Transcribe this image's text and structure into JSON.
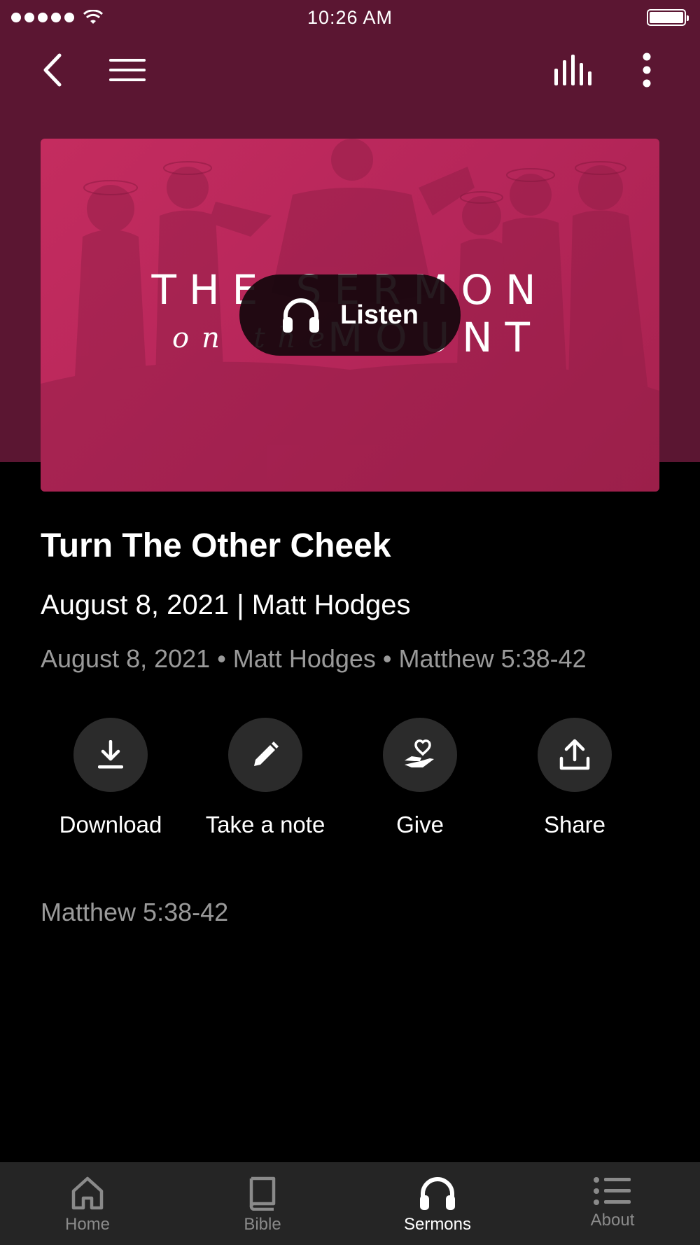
{
  "status_bar": {
    "time": "10:26 AM"
  },
  "artwork": {
    "title_line1": "THE SERMON",
    "title_on": "on the",
    "title_line2": "MOUNT",
    "listen_label": "Listen"
  },
  "sermon": {
    "title": "Turn The Other Cheek",
    "subtitle": "August 8, 2021 | Matt Hodges",
    "meta": "August 8, 2021 • Matt Hodges • Matthew 5:38-42",
    "scripture": "Matthew 5:38-42"
  },
  "actions": [
    {
      "label": "Download",
      "icon": "download-icon"
    },
    {
      "label": "Take a note",
      "icon": "pencil-icon"
    },
    {
      "label": "Give",
      "icon": "give-heart-hand-icon"
    },
    {
      "label": "Share",
      "icon": "share-icon"
    }
  ],
  "tabs": [
    {
      "label": "Home",
      "icon": "home-icon",
      "active": false
    },
    {
      "label": "Bible",
      "icon": "book-icon",
      "active": false
    },
    {
      "label": "Sermons",
      "icon": "headphones-icon",
      "active": true
    },
    {
      "label": "About",
      "icon": "list-icon",
      "active": false
    }
  ],
  "colors": {
    "header": "#5b1632",
    "artwork": "#c42c5f",
    "background": "#000000",
    "tab_bar": "#252525",
    "muted_text": "#9a9a9a"
  }
}
